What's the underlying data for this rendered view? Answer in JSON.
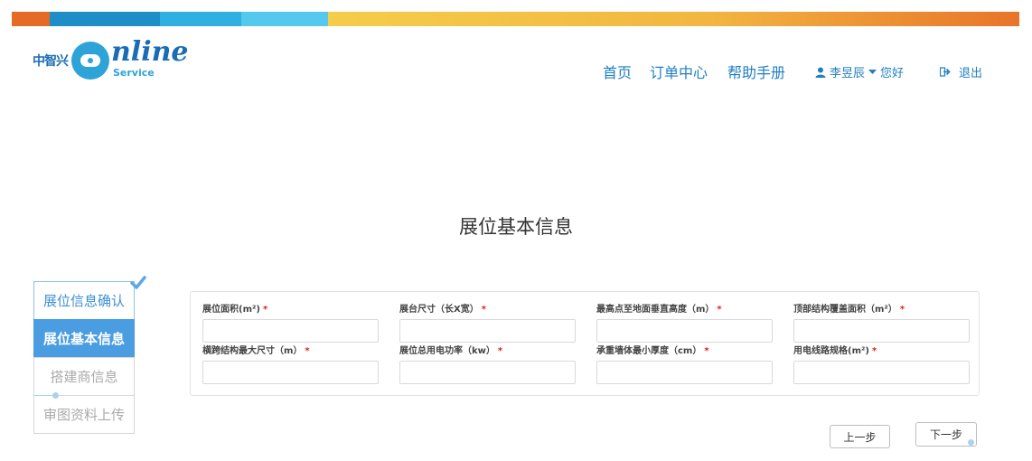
{
  "header": {
    "stripe_colors": [
      "#e56a25",
      "#1e8ec8",
      "#2fb0e0",
      "#55c8ee",
      "#f4cd4a",
      "#f2a63c",
      "#e8742a"
    ],
    "logo": {
      "cn": "中智兴",
      "word": "nline",
      "sub": "Service"
    },
    "nav": {
      "home": "首页",
      "orders": "订单中心",
      "help": "帮助手册"
    },
    "user": {
      "name": "李昱辰",
      "greeting": "您好"
    },
    "logout": "退出"
  },
  "page_title": "展位基本信息",
  "steps": [
    {
      "label": "展位信息确认",
      "state": "done"
    },
    {
      "label": "展位基本信息",
      "state": "active"
    },
    {
      "label": "搭建商信息",
      "state": "todo"
    },
    {
      "label": "审图资料上传",
      "state": "todo"
    }
  ],
  "form": {
    "fields": [
      {
        "label": "展位面积(m²)",
        "required": "*",
        "value": ""
      },
      {
        "label": "展台尺寸（长X宽）",
        "required": "*",
        "value": ""
      },
      {
        "label": "最高点至地面垂直高度（m）",
        "required": "*",
        "value": ""
      },
      {
        "label": "顶部结构覆盖面积（m²）",
        "required": "*",
        "value": ""
      },
      {
        "label": "横跨结构最大尺寸（m）",
        "required": "*",
        "value": ""
      },
      {
        "label": "展位总用电功率（kw）",
        "required": "*",
        "value": ""
      },
      {
        "label": "承重墙体最小厚度（cm）",
        "required": "*",
        "value": ""
      },
      {
        "label": "用电线路规格(m²)",
        "required": "*",
        "value": ""
      }
    ]
  },
  "buttons": {
    "prev": "上一步",
    "next": "下一步"
  }
}
